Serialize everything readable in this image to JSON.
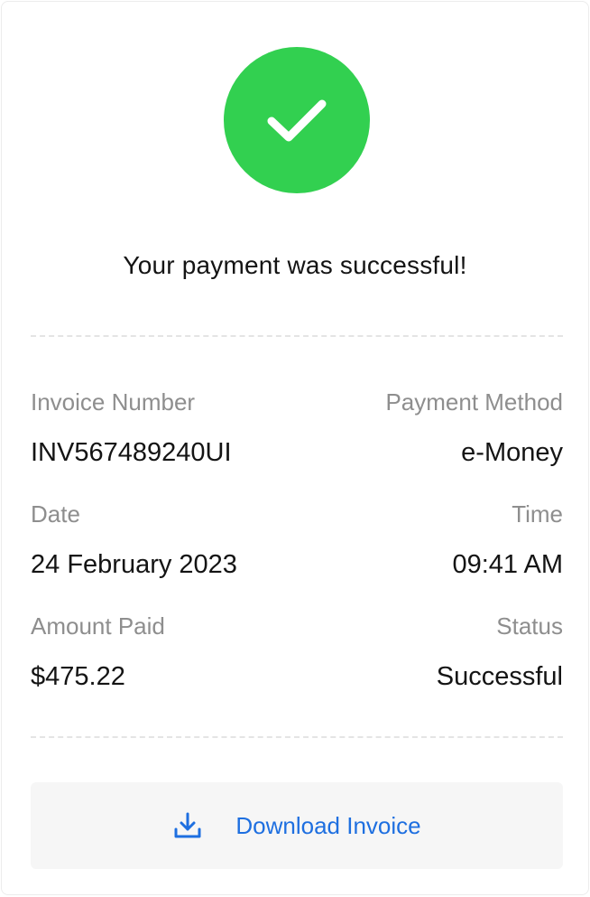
{
  "status": {
    "headline": "Your payment was successful!",
    "icon": "check-circle-icon",
    "accent_color": "#32d050"
  },
  "details": {
    "invoice_number": {
      "label": "Invoice Number",
      "value": "INV567489240UI"
    },
    "payment_method": {
      "label": "Payment Method",
      "value": "e-Money"
    },
    "date": {
      "label": "Date",
      "value": "24 February 2023"
    },
    "time": {
      "label": "Time",
      "value": "09:41 AM"
    },
    "amount_paid": {
      "label": "Amount Paid",
      "value": "$475.22"
    },
    "status": {
      "label": "Status",
      "value": "Successful"
    }
  },
  "actions": {
    "download": {
      "label": "Download Invoice",
      "icon": "download-icon",
      "color": "#1e6fe0"
    }
  }
}
